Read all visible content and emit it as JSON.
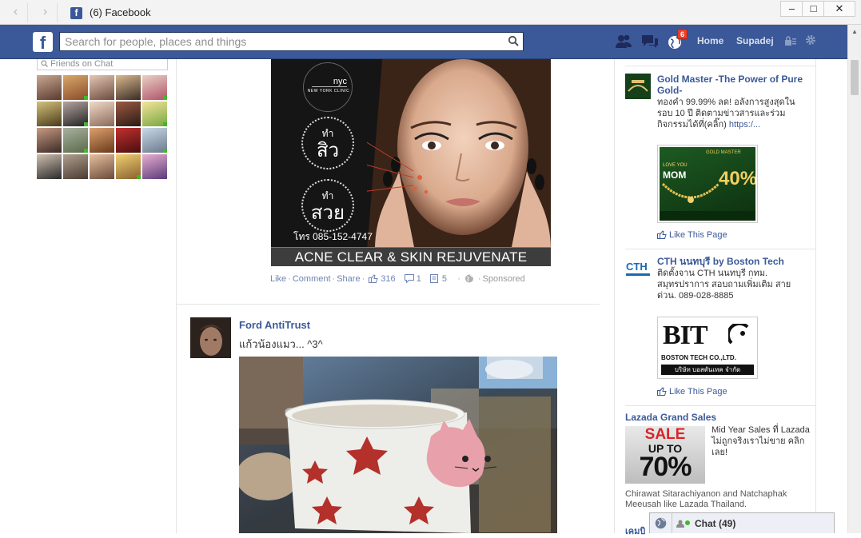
{
  "window": {
    "tab_title": "(6) Facebook",
    "nav_back": "‹",
    "nav_forward": "›",
    "min": "–",
    "max": "□",
    "close": "✕"
  },
  "topbar": {
    "logo": "f",
    "search_placeholder": "Search for people, places and things",
    "notifications_badge": "6",
    "home": "Home",
    "user": "Supadej",
    "brand_color": "#3b5998"
  },
  "left": {
    "chat_search_placeholder": "Friends on Chat"
  },
  "sponsored_post": {
    "image": {
      "logo_top": "nyc",
      "logo_bottom": "NEW YORK CLINIC",
      "circle1_small": "ทำ",
      "circle1_big": "สิว",
      "circle2_small": "ทำ",
      "circle2_big": "สวย",
      "phone": "โทร 085-152-4747",
      "banner": "ACNE CLEAR & SKIN REJUVENATE PROGRAM"
    },
    "actions": {
      "like": "Like",
      "comment": "Comment",
      "share": "Share",
      "sep": "·",
      "likes_count": "316",
      "comments_count": "1",
      "shares_count": "5",
      "sponsored": "Sponsored"
    }
  },
  "post": {
    "author": "Ford AntiTrust",
    "text": "แก้วน้องแมว... ^3^"
  },
  "right_ads": [
    {
      "title": "Gold Master -The Power of Pure Gold-",
      "body": "ทองคำ 99.99% ลด! อลังการสูงสุดในรอบ 10 ปี ติดตามข่าวสารและร่วมกิจกรรมได้ที่(คลิ๊ก)",
      "link": "https:/...",
      "img_brand": "GOLD MASTER",
      "img_mom": "MOM",
      "img_love": "LOVE YOU",
      "img_pct": "40%",
      "like": "Like This Page"
    },
    {
      "title": "CTH นนทบุรี by Boston Tech",
      "body": "ติดตั้งจาน CTH นนทบุรี กทม. สมุทรปราการ สอบถามเพิ่มเติม สายด่วน. 089-028-8885",
      "thumb_text": "CTH",
      "img_big": "BIT",
      "img_sub": "BOSTON TECH CO.,LTD.",
      "img_thai": "บริษัท บอสตันเทค จำกัด",
      "like": "Like This Page"
    }
  ],
  "lazada": {
    "title": "Lazada Grand Sales",
    "img_sale": "SALE",
    "img_upto": "UP TO",
    "img_pct": "70%",
    "body": "Mid Year Sales ที่ Lazada ไม่ถูกจริงเราไม่ขาย คลิกเลย!",
    "social": "Chirawat Sitarachiyanon and Natchaphak Meeusah like Lazada Thailand.",
    "next_title": "เคมบิ"
  },
  "chatbar": {
    "label": "Chat",
    "count": "(49)"
  },
  "colors": {
    "link": "#3b5998",
    "muted_link": "#6d84b4",
    "badge": "#f03d25",
    "online": "#42b72a"
  }
}
